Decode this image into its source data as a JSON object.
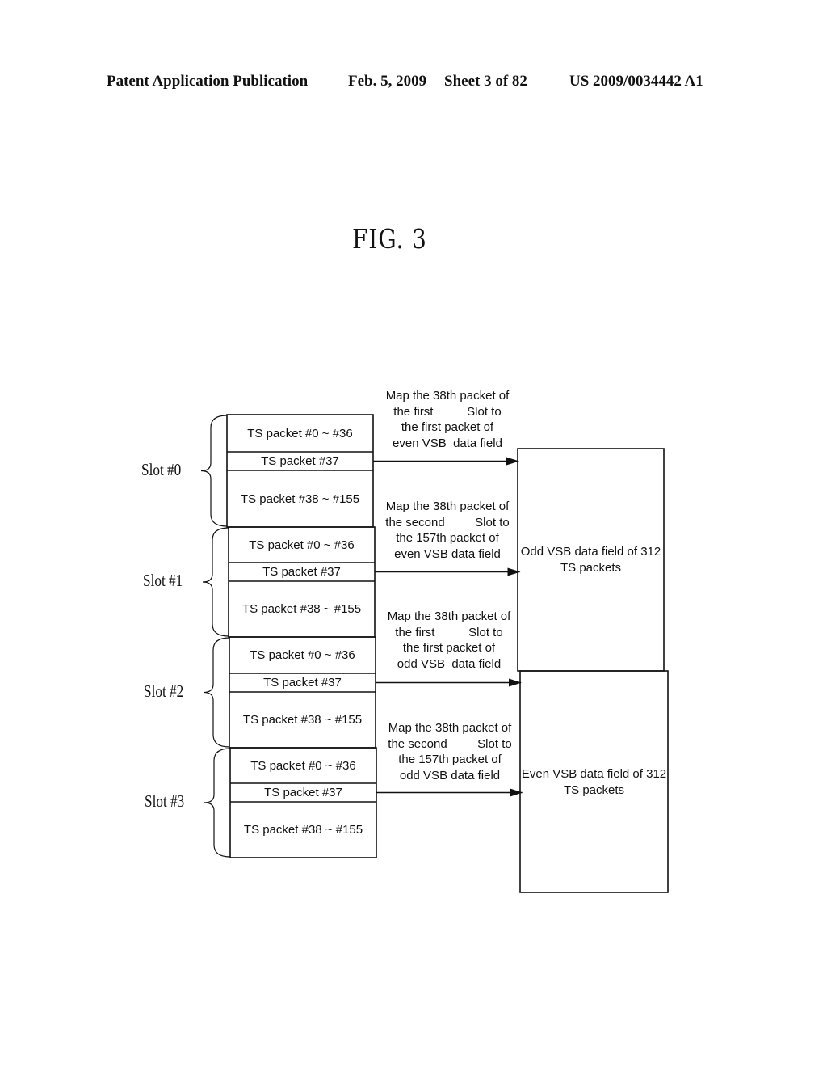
{
  "header": {
    "publication": "Patent Application Publication",
    "date": "Feb. 5, 2009",
    "sheet": "Sheet 3 of 82",
    "number": "US 2009/0034442 A1"
  },
  "figure": {
    "title": "FIG. 3"
  },
  "slots": [
    {
      "label": "Slot #0",
      "packets": [
        "TS packet #0 ~ #36",
        "TS packet #37",
        "TS packet #38 ~ #155"
      ]
    },
    {
      "label": "Slot #1",
      "packets": [
        "TS packet #0 ~ #36",
        "TS packet #37",
        "TS packet #38 ~ #155"
      ]
    },
    {
      "label": "Slot #2",
      "packets": [
        "TS packet #0 ~ #36",
        "TS packet #37",
        "TS packet #38 ~ #155"
      ]
    },
    {
      "label": "Slot #3",
      "packets": [
        "TS packet #0 ~ #36",
        "TS packet #37",
        "TS packet #38 ~ #155"
      ]
    }
  ],
  "mappings": [
    {
      "text": "Map the 38th packet of\nthe first          Slot to\nthe first packet of\neven VSB  data field",
      "from_slot": "Slot #0",
      "to": "Odd VSB data field"
    },
    {
      "text": "Map the 38th packet of\nthe second         Slot to\nthe 157th packet of\neven VSB data field",
      "from_slot": "Slot #1",
      "to": "Odd VSB data field"
    },
    {
      "text": "Map the 38th packet of\nthe first          Slot to\nthe first packet of\nodd VSB  data field",
      "from_slot": "Slot #2",
      "to": "Even VSB data field"
    },
    {
      "text": "Map the 38th packet of\nthe second         Slot to\nthe 157th packet of\nodd VSB data field",
      "from_slot": "Slot #3",
      "to": "Even VSB data field"
    }
  ],
  "data_fields": [
    {
      "label": "Odd VSB data field of 312 TS packets"
    },
    {
      "label": "Even VSB data field of 312 TS packets"
    }
  ]
}
